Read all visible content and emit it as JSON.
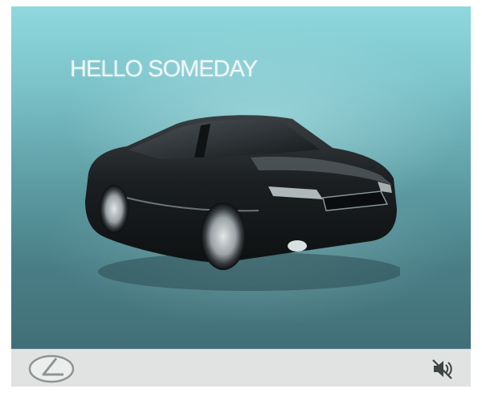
{
  "ad": {
    "headline": "HELLO SOMEDAY",
    "brand_logo_icon": "lexus-logo-icon",
    "car_image": "dark-sedan-image",
    "sound_toggle_icon": "speaker-muted-icon"
  },
  "colors": {
    "background_top": "#8fd8dd",
    "background_bottom": "#426f77",
    "headline_text": "#f2f6f6",
    "bottom_bar": "#e1e3e2",
    "car_body": "#1b1f21"
  }
}
